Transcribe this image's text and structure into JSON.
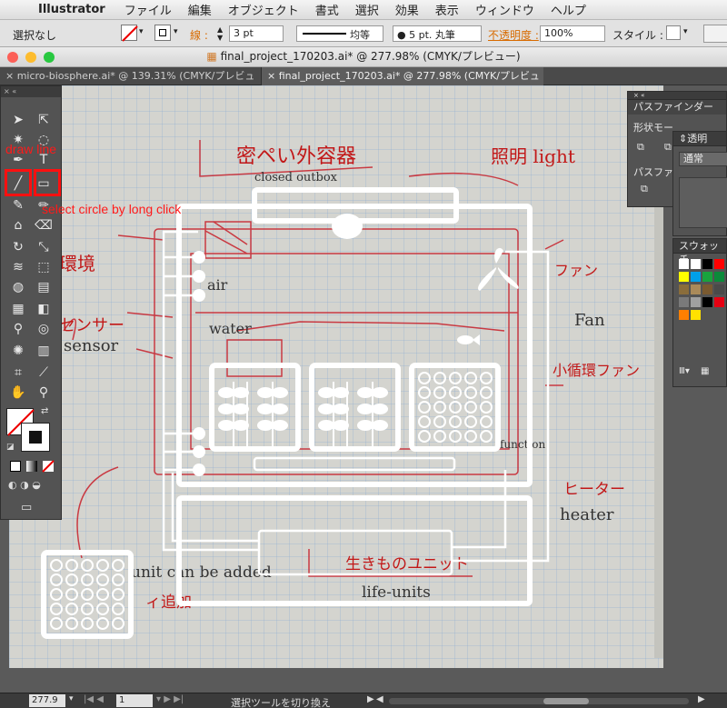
{
  "menubar": {
    "app_name": "Illustrator",
    "items": [
      "ファイル",
      "編集",
      "オブジェクト",
      "書式",
      "選択",
      "効果",
      "表示",
      "ウィンドウ",
      "ヘルプ"
    ]
  },
  "control_bar": {
    "selection": "選択なし",
    "stroke_label": "線 :",
    "stroke_value": "3 pt",
    "profile_label": "均等",
    "brush_label": "5 pt. 丸筆",
    "opacity_label": "不透明度 :",
    "opacity_value": "100%",
    "style_label": "スタイル :"
  },
  "window": {
    "title": "final_project_170203.ai* @ 277.98% (CMYK/プレビュー)"
  },
  "tabs": [
    {
      "label": "micro-biosphere.ai* @ 139.31% (CMYK/プレビュー)"
    },
    {
      "label": "final_project_170203.ai* @ 277.98% (CMYK/プレビュー)"
    }
  ],
  "annotations": {
    "draw_line": "draw line",
    "select_circle": "select circle by long click"
  },
  "sketch_text": {
    "title_jp": "密ペい外容器",
    "closed_outbox": "closed outbox",
    "light_jp": "照明 light",
    "env": "環境",
    "sensor_jp": "センサー",
    "sensor": "sensor",
    "air": "air",
    "water": "water",
    "fan_jp": "ファン",
    "fan": "Fan",
    "circ_fan": "小循環ファン",
    "function": "function",
    "heater_jp": "ヒーター",
    "heater": "heater",
    "unit_add": "unit can be added",
    "add_jp": "ィ追加",
    "lifeunits_jp": "生きものユニット",
    "lifeunits": "life-units"
  },
  "panels": {
    "pathfinder": {
      "title": "パスファインダー",
      "shape_mode": "形状モー",
      "pathfinder": "パスファ"
    },
    "transparency": {
      "title": "透明",
      "mode": "通常"
    },
    "swatches": {
      "title": "スウォッチ"
    }
  },
  "swatch_colors": [
    "#ffffff",
    "#ffffff",
    "#000000",
    "#ff0000",
    "#ffff00",
    "#00a0e9",
    "#19a33d",
    "#0b8a3a",
    "#8a6d3b",
    "#aa8a5a",
    "#7a5a30",
    "#4a4a4a",
    "#7a7a7a",
    "#a0a0a0",
    "#000000",
    "#e60012",
    "#ff7f00",
    "#ffe100"
  ],
  "status_bar": {
    "zoom": "277.9",
    "page": "1",
    "tool_hint": "選択ツールを切り換え"
  }
}
